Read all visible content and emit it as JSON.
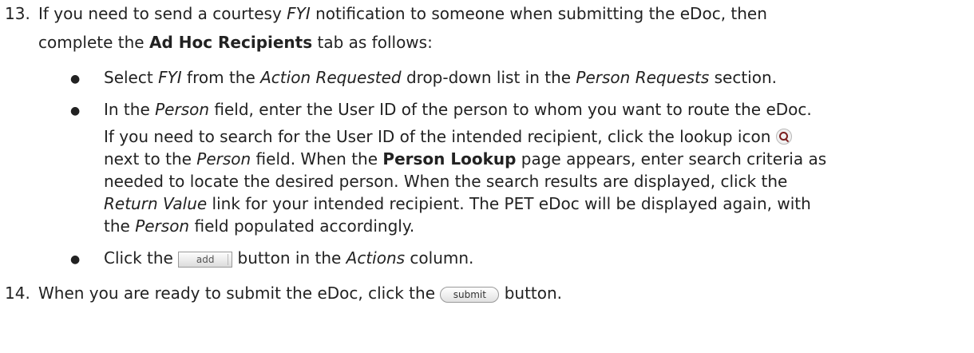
{
  "step13": {
    "number": "13.",
    "line1": {
      "a": "If you need to send a courtesy ",
      "fyi": "FYI",
      "b": " notification to someone when submitting the eDoc, then"
    },
    "line2": {
      "a": "complete the ",
      "tab": "Ad Hoc Recipients",
      "b": " tab as follows:"
    },
    "bullet1": {
      "a": "Select ",
      "fyi": "FYI",
      "b": " from the ",
      "action": "Action Requested",
      "c": " drop-down list in the ",
      "section": "Person Requests",
      "d": " section."
    },
    "bullet2": {
      "line1": {
        "a": "In the ",
        "field": "Person",
        "b": " field, enter the User ID of the person to whom you want to route the eDoc."
      },
      "line2": "If you need to search for the User ID of the intended recipient, click the lookup icon",
      "line3": {
        "a": "next to the ",
        "field": "Person",
        "b": " field. When the ",
        "page": "Person Lookup",
        "c": " page appears, enter search criteria as"
      },
      "line4": "needed to locate the desired person. When the search results are displayed, click the",
      "line5": {
        "link": "Return Value",
        "b": " link for your intended recipient. The PET eDoc will be displayed again, with"
      },
      "line6": {
        "a": "the ",
        "field": "Person",
        "b": " field populated accordingly."
      }
    },
    "bullet3": {
      "a": "Click the ",
      "b": " button in the ",
      "col": "Actions",
      "c": " column."
    },
    "add_button": "add"
  },
  "step14": {
    "number": "14.",
    "a": "When you are ready to submit the eDoc, click the ",
    "b": " button.",
    "submit_button": "submit"
  },
  "bullet_glyph": "●",
  "icons": {
    "lookup": "magnifier-icon"
  }
}
